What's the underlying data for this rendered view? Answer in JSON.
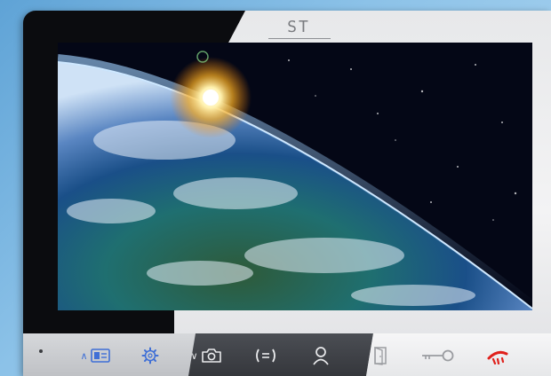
{
  "brand": {
    "logo_text": "ST"
  },
  "screen": {
    "content": "earth-from-orbit-wallpaper"
  },
  "controls": {
    "left": [
      {
        "name": "monitor-toggle-button",
        "icon": "monitor-icon",
        "prefix": "∧",
        "color": "#3f6fd6"
      },
      {
        "name": "settings-button",
        "icon": "gear-icon",
        "color": "#3f6fd6"
      }
    ],
    "middle": [
      {
        "name": "photo-button",
        "icon": "camera-icon",
        "prefix": "∨",
        "color": "#e9eaec"
      },
      {
        "name": "intercom-button",
        "icon": "transfer-icon",
        "color": "#e9eaec"
      },
      {
        "name": "contacts-button",
        "icon": "person-icon",
        "color": "#e9eaec"
      }
    ],
    "right": [
      {
        "name": "door-button",
        "icon": "door-icon",
        "color": "#9a9ca0"
      },
      {
        "name": "unlock-button",
        "icon": "key-icon",
        "color": "#9a9ca0"
      },
      {
        "name": "hangup-button",
        "icon": "hangup-icon",
        "color": "#e0201b"
      }
    ]
  }
}
